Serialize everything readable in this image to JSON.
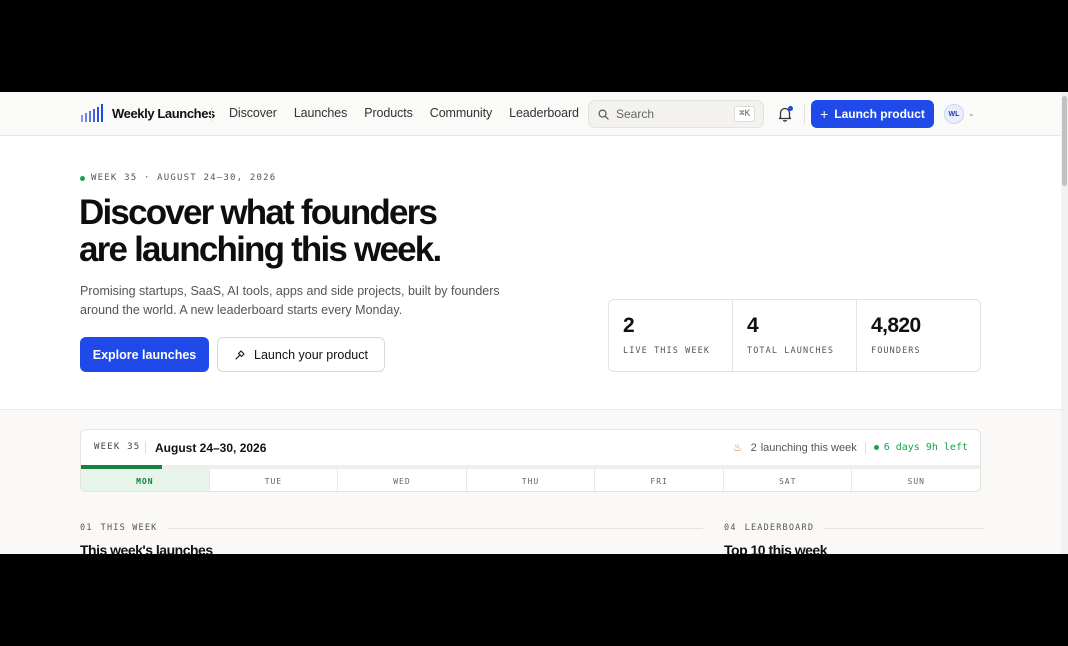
{
  "header": {
    "logo_text": "Weekly Launches",
    "nav": [
      "Discover",
      "Launches",
      "Products",
      "Community",
      "Leaderboard"
    ],
    "search_placeholder": "Search",
    "search_shortcut": "⌘K",
    "launch_button": "Launch product",
    "avatar_initials": "WL"
  },
  "hero": {
    "eyebrow": "WEEK 35 · AUGUST 24–30, 2026",
    "title_line1": "Discover what founders",
    "title_line2": "are launching this week.",
    "subtitle": "Promising startups, SaaS, AI tools, apps and side projects, built by founders around the world. A new leaderboard starts every Monday.",
    "explore_button": "Explore launches",
    "launch_button": "Launch your product"
  },
  "stats": [
    {
      "value": "2",
      "label": "LIVE THIS WEEK"
    },
    {
      "value": "4",
      "label": "TOTAL LAUNCHES"
    },
    {
      "value": "4,820",
      "label": "FOUNDERS"
    }
  ],
  "week": {
    "tag": "WEEK 35",
    "date": "August 24–30, 2026",
    "launching_count": "2",
    "launching_text": "launching this week",
    "time_left": "6 days 9h left",
    "progress": 0.09,
    "days": [
      "MON",
      "TUE",
      "WED",
      "THU",
      "FRI",
      "SAT",
      "SUN"
    ],
    "active_day": "MON"
  },
  "sections": {
    "left_num": "01",
    "left_label": "THIS WEEK",
    "left_title": "This week's launches",
    "right_num": "04",
    "right_label": "LEADERBOARD",
    "right_title": "Top 10 this week"
  },
  "colors": {
    "accent": "#1f49e8",
    "success": "#16823f",
    "flame": "#e8732a"
  }
}
